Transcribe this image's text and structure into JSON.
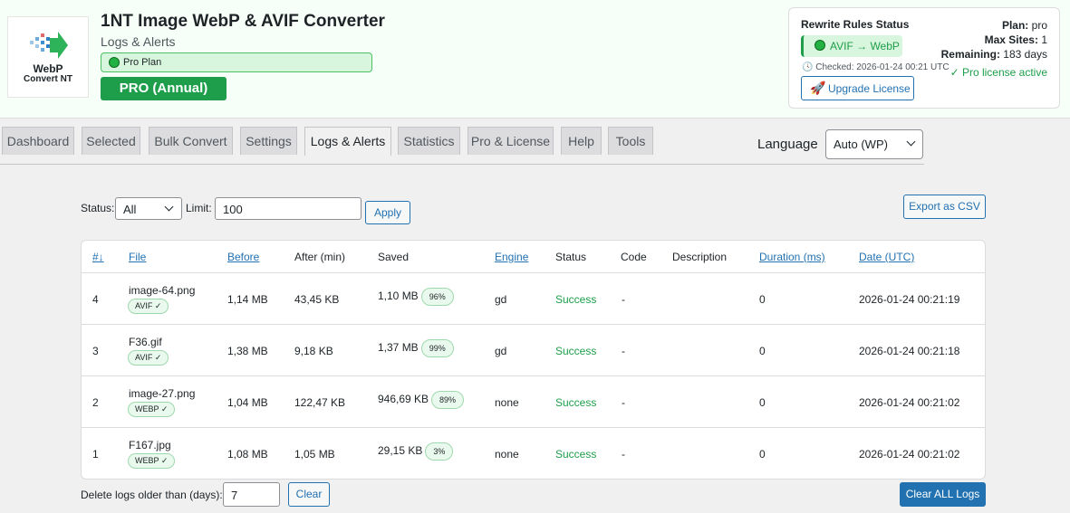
{
  "header": {
    "logo_line1": "WebP",
    "logo_line2": "Convert NT",
    "title": "1NT Image WebP & AVIF Converter",
    "subtitle": "Logs & Alerts",
    "plan_badge": "Pro Plan",
    "plan_button": "PRO (Annual)"
  },
  "rewrite": {
    "title": "Rewrite Rules Status",
    "status": "AVIF → WebP",
    "checked": "Checked: 2026-01-24 00:21 UTC",
    "upgrade_label": "Upgrade License",
    "plan_label": "Plan:",
    "plan_value": "pro",
    "sites_label": "Max Sites:",
    "sites_value": "1",
    "remaining_label": "Remaining:",
    "remaining_value": "183 days",
    "active": "✓ Pro license active"
  },
  "tabs": [
    "Dashboard",
    "Selected",
    "Bulk Convert",
    "Settings",
    "Logs & Alerts",
    "Statistics",
    "Pro & License",
    "Help",
    "Tools"
  ],
  "language": {
    "label": "Language",
    "value": "Auto (WP)"
  },
  "filter": {
    "status_label": "Status:",
    "status_value": "All",
    "limit_label": "Limit:",
    "limit_value": "100",
    "apply": "Apply",
    "export": "Export as CSV"
  },
  "table": {
    "columns": [
      "#↓",
      "File",
      "Before",
      "After (min)",
      "Saved",
      "Engine",
      "Status",
      "Code",
      "Description",
      "Duration (ms)",
      "Date (UTC)"
    ],
    "rows": [
      {
        "id": "4",
        "file": "image-64.png",
        "format": "AVIF ✓",
        "before": "1,14 MB",
        "after": "43,45 KB",
        "saved": "1,10 MB",
        "pct": "96%",
        "engine": "gd",
        "status": "Success",
        "code": "-",
        "desc": "",
        "duration": "0",
        "date": "2026-01-24 00:21:19"
      },
      {
        "id": "3",
        "file": "F36.gif",
        "format": "AVIF ✓",
        "before": "1,38 MB",
        "after": "9,18 KB",
        "saved": "1,37 MB",
        "pct": "99%",
        "engine": "gd",
        "status": "Success",
        "code": "-",
        "desc": "",
        "duration": "0",
        "date": "2026-01-24 00:21:18"
      },
      {
        "id": "2",
        "file": "image-27.png",
        "format": "WEBP ✓",
        "before": "1,04 MB",
        "after": "122,47 KB",
        "saved": "946,69 KB",
        "pct": "89%",
        "engine": "none",
        "status": "Success",
        "code": "-",
        "desc": "",
        "duration": "0",
        "date": "2026-01-24 00:21:02"
      },
      {
        "id": "1",
        "file": "F167.jpg",
        "format": "WEBP ✓",
        "before": "1,08 MB",
        "after": "1,05 MB",
        "saved": "29,15 KB",
        "pct": "3%",
        "engine": "none",
        "status": "Success",
        "code": "-",
        "desc": "",
        "duration": "0",
        "date": "2026-01-24 00:21:02"
      }
    ]
  },
  "footer": {
    "days_label": "Delete logs older than (days):",
    "days_value": "7",
    "clear": "Clear",
    "clear_all": "Clear ALL Logs"
  }
}
